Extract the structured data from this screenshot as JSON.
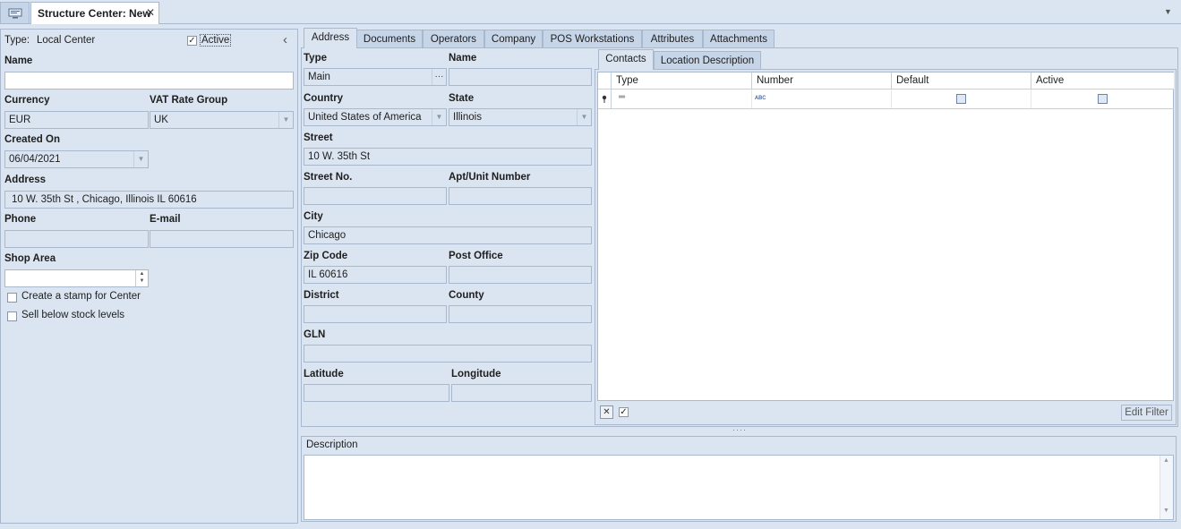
{
  "titlebar": {
    "tab_title": "Structure Center: New",
    "close_glyph": "✕",
    "menu_glyph": "▼"
  },
  "left": {
    "type_label": "Type:",
    "type_value": "Local Center",
    "active_label": "Active",
    "active_checked": true,
    "collapse_glyph": "‹",
    "name_label": "Name",
    "name_value": "",
    "currency_label": "Currency",
    "currency_value": "EUR",
    "vat_label": "VAT Rate Group",
    "vat_value": "UK",
    "created_label": "Created On",
    "created_value": "06/04/2021",
    "address_label": "Address",
    "address_value": "10 W. 35th St , Chicago, Illinois IL 60616",
    "phone_label": "Phone",
    "phone_value": "",
    "email_label": "E-mail",
    "email_value": "",
    "shop_area_label": "Shop Area",
    "shop_area_value": "",
    "stamp_label": "Create a stamp for Center",
    "sell_below_label": "Sell below stock levels"
  },
  "tabs": [
    "Address",
    "Documents",
    "Operators",
    "Company",
    "POS Workstations",
    "Attributes",
    "Attachments"
  ],
  "address": {
    "type_label": "Type",
    "type_value": "Main",
    "ellipsis": "···",
    "name_label": "Name",
    "name_value": "",
    "country_label": "Country",
    "country_value": "United States of America",
    "state_label": "State",
    "state_value": "Illinois",
    "street_label": "Street",
    "street_value": "10 W. 35th St",
    "street_no_label": "Street No.",
    "street_no_value": "",
    "apt_label": "Apt/Unit Number",
    "apt_value": "",
    "city_label": "City",
    "city_value": "Chicago",
    "zip_label": "Zip Code",
    "zip_value": "IL 60616",
    "post_office_label": "Post Office",
    "post_office_value": "",
    "district_label": "District",
    "district_value": "",
    "county_label": "County",
    "county_value": "",
    "gln_label": "GLN",
    "gln_value": "",
    "latitude_label": "Latitude",
    "latitude_value": "",
    "longitude_label": "Longitude",
    "longitude_value": ""
  },
  "contacts": {
    "tabs": [
      "Contacts",
      "Location Description"
    ],
    "columns": [
      "Type",
      "Number",
      "Default",
      "Active"
    ],
    "filter_row_type_glyph": "═",
    "filter_row_number_glyph": "ᴀʙᴄ",
    "edit_filter_label": "Edit Filter"
  },
  "description": {
    "label": "Description",
    "value": ""
  }
}
